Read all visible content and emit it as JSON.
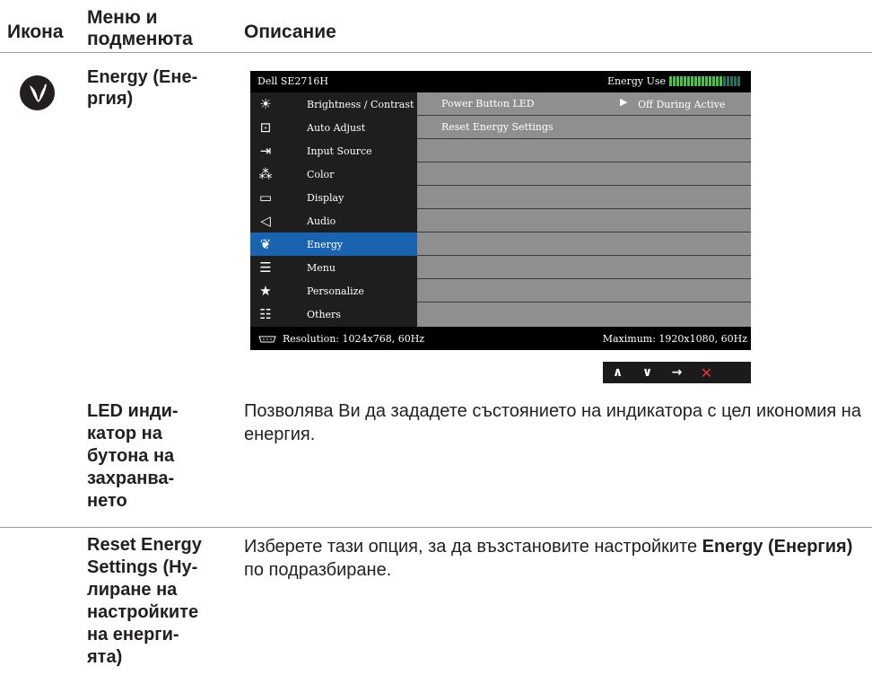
{
  "headers": {
    "icon": "Икона",
    "menu": "Меню и\nподменюта",
    "description": "Описание"
  },
  "energy_row": {
    "icon": "energy-leaf-icon",
    "menu": "Energy (Ене-\nргия)"
  },
  "osd": {
    "model": "Dell SE2716H",
    "energy_use_label": "Energy Use",
    "energy_meter": {
      "filled": 15,
      "total": 20
    },
    "menu_items": [
      {
        "label": "Brightness / Contrast",
        "icon": "brightness-icon"
      },
      {
        "label": "Auto Adjust",
        "icon": "auto-adjust-icon"
      },
      {
        "label": "Input Source",
        "icon": "input-source-icon"
      },
      {
        "label": "Color",
        "icon": "color-icon"
      },
      {
        "label": "Display",
        "icon": "display-icon"
      },
      {
        "label": "Audio",
        "icon": "audio-icon"
      },
      {
        "label": "Energy",
        "icon": "energy-icon",
        "active": true
      },
      {
        "label": "Menu",
        "icon": "menu-icon"
      },
      {
        "label": "Personalize",
        "icon": "star-icon"
      },
      {
        "label": "Others",
        "icon": "others-icon"
      }
    ],
    "submenu": [
      {
        "label": "Power Button LED",
        "value": "Off During Active"
      },
      {
        "label": "Reset Energy Settings",
        "value": ""
      }
    ],
    "resolution": "Resolution: 1024x768, 60Hz",
    "maximum": "Maximum: 1920x1080, 60Hz",
    "nav_buttons": [
      "up-icon",
      "down-icon",
      "right-arrow-icon",
      "close-icon"
    ],
    "colors": {
      "active": "#1a63b0",
      "meter": "#4cc24c",
      "close": "#e8303b"
    }
  },
  "items": [
    {
      "menu": "LED инди-\nкатор на\nбутона на\nзахранва-\nнето",
      "description": "Позволява Ви да зададете състоянието на индикатора с цел икономия на енергия."
    },
    {
      "menu": "Reset Energy\nSettings (Ну-\nлиране на\nнастройките\nна енерги-\nята)",
      "description_pre": "Изберете тази опция, за да възстановите настройките ",
      "description_bold": "Energy (Енергия)",
      "description_post": " по подразбиране."
    }
  ]
}
